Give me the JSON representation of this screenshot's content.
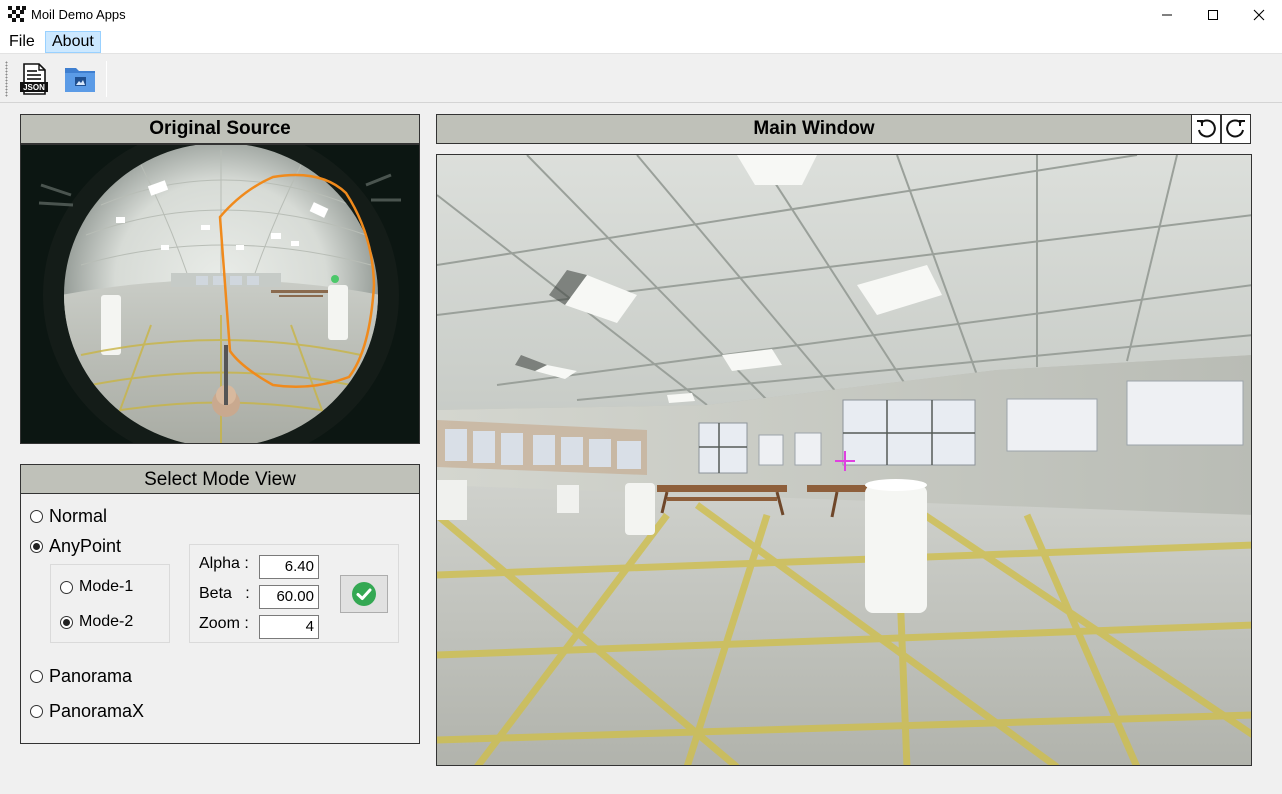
{
  "window": {
    "title": "Moil Demo Apps",
    "icons": {
      "app": "checkerboard-app-icon",
      "minimize": "minimize-icon",
      "maximize": "maximize-icon",
      "close": "close-icon"
    }
  },
  "menu": {
    "items": [
      "File",
      "About"
    ]
  },
  "toolbar": {
    "buttons": [
      "json-file-icon",
      "open-image-folder-icon"
    ],
    "json_badge": "JSON"
  },
  "source_panel": {
    "title": "Original Source"
  },
  "main_panel": {
    "title": "Main Window",
    "buttons": [
      "rotate-left-icon",
      "rotate-right-icon"
    ],
    "marker_color": "#e040e0"
  },
  "mode_panel": {
    "title": "Select Mode View",
    "modes": [
      {
        "label": "Normal",
        "selected": false
      },
      {
        "label": "AnyPoint",
        "selected": true
      },
      {
        "label": "Panorama",
        "selected": false
      },
      {
        "label": "PanoramaX",
        "selected": false
      }
    ],
    "submodes": [
      {
        "label": "Mode-1",
        "selected": false
      },
      {
        "label": "Mode-2",
        "selected": true
      }
    ],
    "params": {
      "alpha_label": "Alpha :",
      "alpha_value": "6.40",
      "beta_label": "Beta   :",
      "beta_value": "60.00",
      "zoom_label": "Zoom :",
      "zoom_value": "4"
    },
    "apply_icon": "green-checkmark-icon"
  },
  "colors": {
    "header_bg": "#bfc1b9",
    "roi_outline": "#f08a1c",
    "accent_green": "#34a853"
  }
}
